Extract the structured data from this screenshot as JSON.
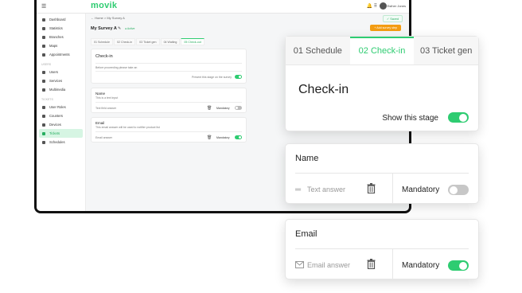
{
  "topbar": {
    "logo": "movik",
    "user_name": "Esther Jones",
    "menu_icon": "hamburger-icon",
    "icons": [
      "bell-icon",
      "grid-icon"
    ]
  },
  "sidebar": {
    "items_top": [
      {
        "label": "Dashboard",
        "icon": "dashboard-icon"
      },
      {
        "label": "Statistics",
        "icon": "chart-icon"
      },
      {
        "label": "Branches",
        "icon": "building-icon"
      },
      {
        "label": "Maps",
        "icon": "map-icon"
      },
      {
        "label": "Appointments",
        "icon": "calendar-icon"
      }
    ],
    "items_mid": [
      {
        "label": "Users",
        "icon": "users-icon"
      },
      {
        "label": "Services",
        "icon": "services-icon"
      },
      {
        "label": "Multimedia",
        "icon": "media-icon"
      }
    ],
    "items_bot": [
      {
        "label": "User Roles",
        "icon": "roles-icon"
      },
      {
        "label": "Counters",
        "icon": "counter-icon"
      },
      {
        "label": "Devices",
        "icon": "device-icon"
      },
      {
        "label": "Tickets",
        "icon": "ticket-icon"
      },
      {
        "label": "Schedules",
        "icon": "schedule-icon"
      }
    ],
    "active": "Tickets"
  },
  "main": {
    "breadcrumb": "←   Home   >   My Survey A",
    "save_status": "✓ Saved",
    "page_title": "My Survey A",
    "page_status": "● Active",
    "action_button": "+ Add survey step",
    "mini_tabs": [
      "01 Schedule",
      "02 Check-in",
      "03 Ticket gen",
      "04 Waiting",
      "05 Check-out"
    ],
    "mini_active_tab": 4,
    "checkin_card": {
      "title": "Check-in",
      "hint": "Before proceeding please take an",
      "show_label": "Present this stage on the survey"
    },
    "name_field": {
      "title": "Name",
      "desc": "This is a text input",
      "placeholder": "Text field answer",
      "mandatory": "Mandatory"
    },
    "email_field": {
      "title": "Email",
      "desc": "This email answer will be used to notifier product list",
      "placeholder": "Email answer",
      "mandatory": "Mandatory"
    }
  },
  "callout_tabs": {
    "tabs": [
      "01  Schedule",
      "02  Check-in",
      "03  Ticket gen"
    ],
    "active": 1,
    "stage_title": "Check-in",
    "show_stage_label": "Show this stage",
    "show_stage_on": true
  },
  "callout_name": {
    "title": "Name",
    "placeholder": "Text answer",
    "mandatory_label": "Mandatory",
    "mandatory_on": false,
    "input_icon": "text-lines-icon",
    "delete_icon": "trash-icon"
  },
  "callout_email": {
    "title": "Email",
    "placeholder": "Email answer",
    "mandatory_label": "Mandatory",
    "mandatory_on": true,
    "input_icon": "envelope-icon",
    "delete_icon": "trash-icon"
  },
  "colors": {
    "accent": "#2ecc71",
    "accent_light": "#d6f5e3",
    "orange": "#f39c12",
    "frame": "#111111"
  }
}
